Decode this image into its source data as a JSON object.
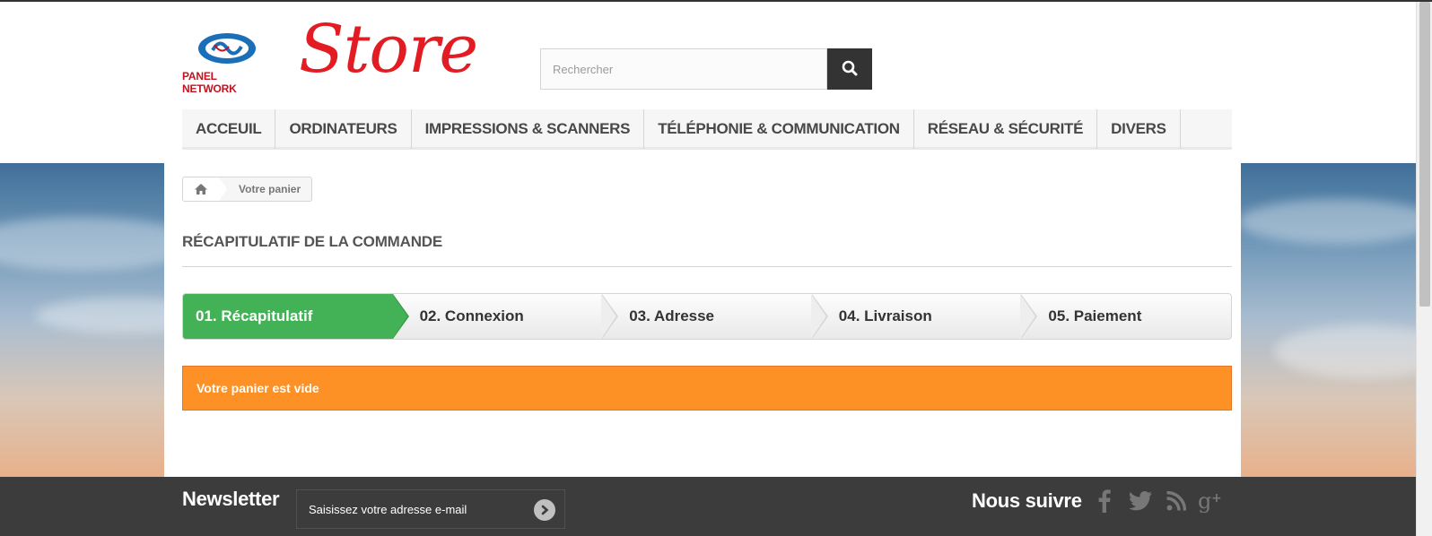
{
  "header": {
    "logo_text": "PANEL NETWORK",
    "store_text": "Store",
    "search_placeholder": "Rechercher"
  },
  "menu": [
    {
      "label": "ACCEUIL"
    },
    {
      "label": "ORDINATEURS"
    },
    {
      "label": "IMPRESSIONS & SCANNERS"
    },
    {
      "label": "TÉLÉPHONIE & COMMUNICATION"
    },
    {
      "label": "RÉSEAU & SÉCURITÉ"
    },
    {
      "label": "DIVERS"
    }
  ],
  "breadcrumb": {
    "home_icon": "home-icon",
    "current": "Votre panier"
  },
  "page_heading": "RÉCAPITULATIF DE LA COMMANDE",
  "steps": [
    {
      "label": "01. Récapitulatif",
      "active": true
    },
    {
      "label": "02. Connexion",
      "active": false
    },
    {
      "label": "03. Adresse",
      "active": false
    },
    {
      "label": "04. Livraison",
      "active": false
    },
    {
      "label": "05. Paiement",
      "active": false
    }
  ],
  "alert": "Votre panier est vide",
  "footer": {
    "newsletter_title": "Newsletter",
    "newsletter_placeholder": "Saisissez votre adresse e-mail",
    "follow_title": "Nous suivre",
    "social": [
      "facebook-icon",
      "twitter-icon",
      "rss-icon",
      "google-plus-icon"
    ]
  },
  "colors": {
    "active_step": "#43b155",
    "alert": "#fe9126",
    "brand_red": "#e31b23",
    "footer_bg": "#3c3c3c"
  }
}
